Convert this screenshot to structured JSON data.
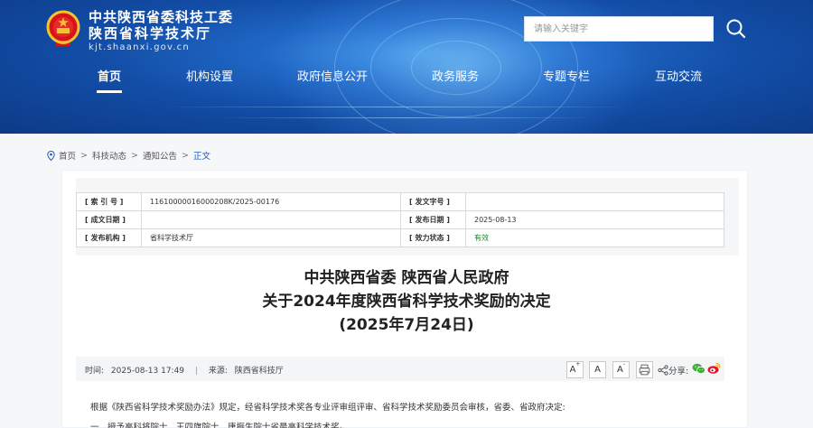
{
  "header": {
    "org_title": "中共陕西省委科技工委",
    "org_subtitle": "陕西省科学技术厅",
    "site_url": "kjt.shaanxi.gov.cn",
    "search_placeholder": "请输入关键字"
  },
  "nav": {
    "items": [
      {
        "label": "首页"
      },
      {
        "label": "机构设置"
      },
      {
        "label": "政府信息公开"
      },
      {
        "label": "政务服务"
      },
      {
        "label": "专题专栏"
      },
      {
        "label": "互动交流"
      }
    ]
  },
  "breadcrumb": {
    "items": [
      "首页",
      "科技动态",
      "通知公告"
    ],
    "current": "正文",
    "separator": ">"
  },
  "meta": {
    "index_label": "[ 索 引 号 ]",
    "index_value": "11610000016000208K/2025-00176",
    "doc_no_label": "[ 发文字号 ]",
    "doc_no_value": "",
    "created_label": "[ 成文日期 ]",
    "created_value": "",
    "publish_label": "[ 发布日期 ]",
    "publish_value": "2025-08-13",
    "agency_label": "[ 发布机构 ]",
    "agency_value": "省科学技术厅",
    "status_label": "[ 效力状态 ]",
    "status_value": "有效"
  },
  "document": {
    "title_line1": "中共陕西省委 陕西省人民政府",
    "title_line2": "关于2024年度陕西省科学技术奖励的决定",
    "title_line3": "(2025年7月24日)",
    "time_label": "时间:",
    "time_value": "2025-08-13 17:49",
    "source_label": "来源:",
    "source_value": "陕西省科技厅",
    "share_label": "分享:",
    "para1": "根据《陕西省科学技术奖励办法》规定，经省科学技术奖各专业评审组评审、省科学技术奖励委员会审核，省委、省政府决定:",
    "para2": "一、授予高科将院士、王四旗院士、唐振生院士省最高科学技术奖。"
  },
  "colors": {
    "header_blue": "#1f66c4",
    "link_blue": "#1f57b5",
    "valid_green": "#1a8a2f",
    "wechat_green": "#3cb034",
    "weibo_red": "#e6162d"
  }
}
